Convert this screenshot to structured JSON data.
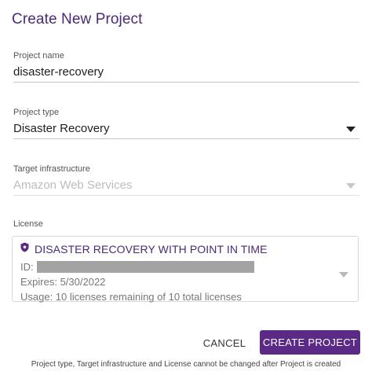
{
  "dialog": {
    "title": "Create New Project"
  },
  "project_name": {
    "label": "Project name",
    "value": "disaster-recovery"
  },
  "project_type": {
    "label": "Project type",
    "selected": "Disaster Recovery"
  },
  "target_infrastructure": {
    "label": "Target infrastructure",
    "selected": "Amazon Web Services",
    "disabled": true
  },
  "license": {
    "label": "License",
    "name": "DISASTER RECOVERY WITH POINT IN TIME",
    "id_label": "ID:",
    "expires": "Expires:  5/30/2022",
    "usage": "Usage: 10 licenses remaining of 10 total licenses",
    "icon": "shield-icon"
  },
  "actions": {
    "cancel_label": "CANCEL",
    "create_label": "CREATE PROJECT"
  },
  "footer": {
    "note": "Project type, Target infrastructure and License cannot be changed after Project is created"
  },
  "colors": {
    "brand": "#5b2a86",
    "title": "#4a2a75"
  }
}
